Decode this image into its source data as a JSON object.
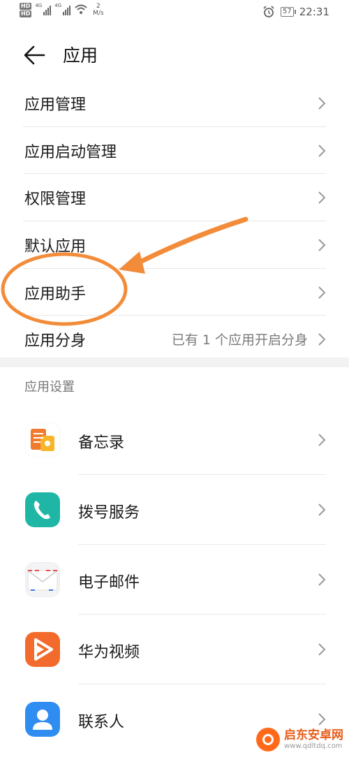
{
  "status_bar": {
    "hd_1": "HD",
    "hd_2": "HD",
    "net_1": "4G",
    "net_2": "4G",
    "speed_value": "2",
    "speed_unit": "M/s",
    "battery": "57",
    "time": "22:31"
  },
  "header": {
    "title": "应用"
  },
  "menu": {
    "items": [
      {
        "label": "应用管理"
      },
      {
        "label": "应用启动管理"
      },
      {
        "label": "权限管理"
      },
      {
        "label": "默认应用"
      },
      {
        "label": "应用助手"
      },
      {
        "label": "应用分身",
        "value": "已有 1 个应用开启分身"
      }
    ]
  },
  "settings": {
    "section_title": "应用设置",
    "apps": [
      {
        "label": "备忘录",
        "color": "#F07A2E"
      },
      {
        "label": "拨号服务",
        "color": "#1FB6A6"
      },
      {
        "label": "电子邮件",
        "color": "#F4F4F6"
      },
      {
        "label": "华为视频",
        "color": "#F26B2C"
      },
      {
        "label": "联系人",
        "color": "#2F8CF0"
      }
    ]
  },
  "annotation": {
    "color": "#F28C3A"
  },
  "watermark": {
    "brand": "启东安卓网",
    "url": "www.qdltdq.com"
  }
}
